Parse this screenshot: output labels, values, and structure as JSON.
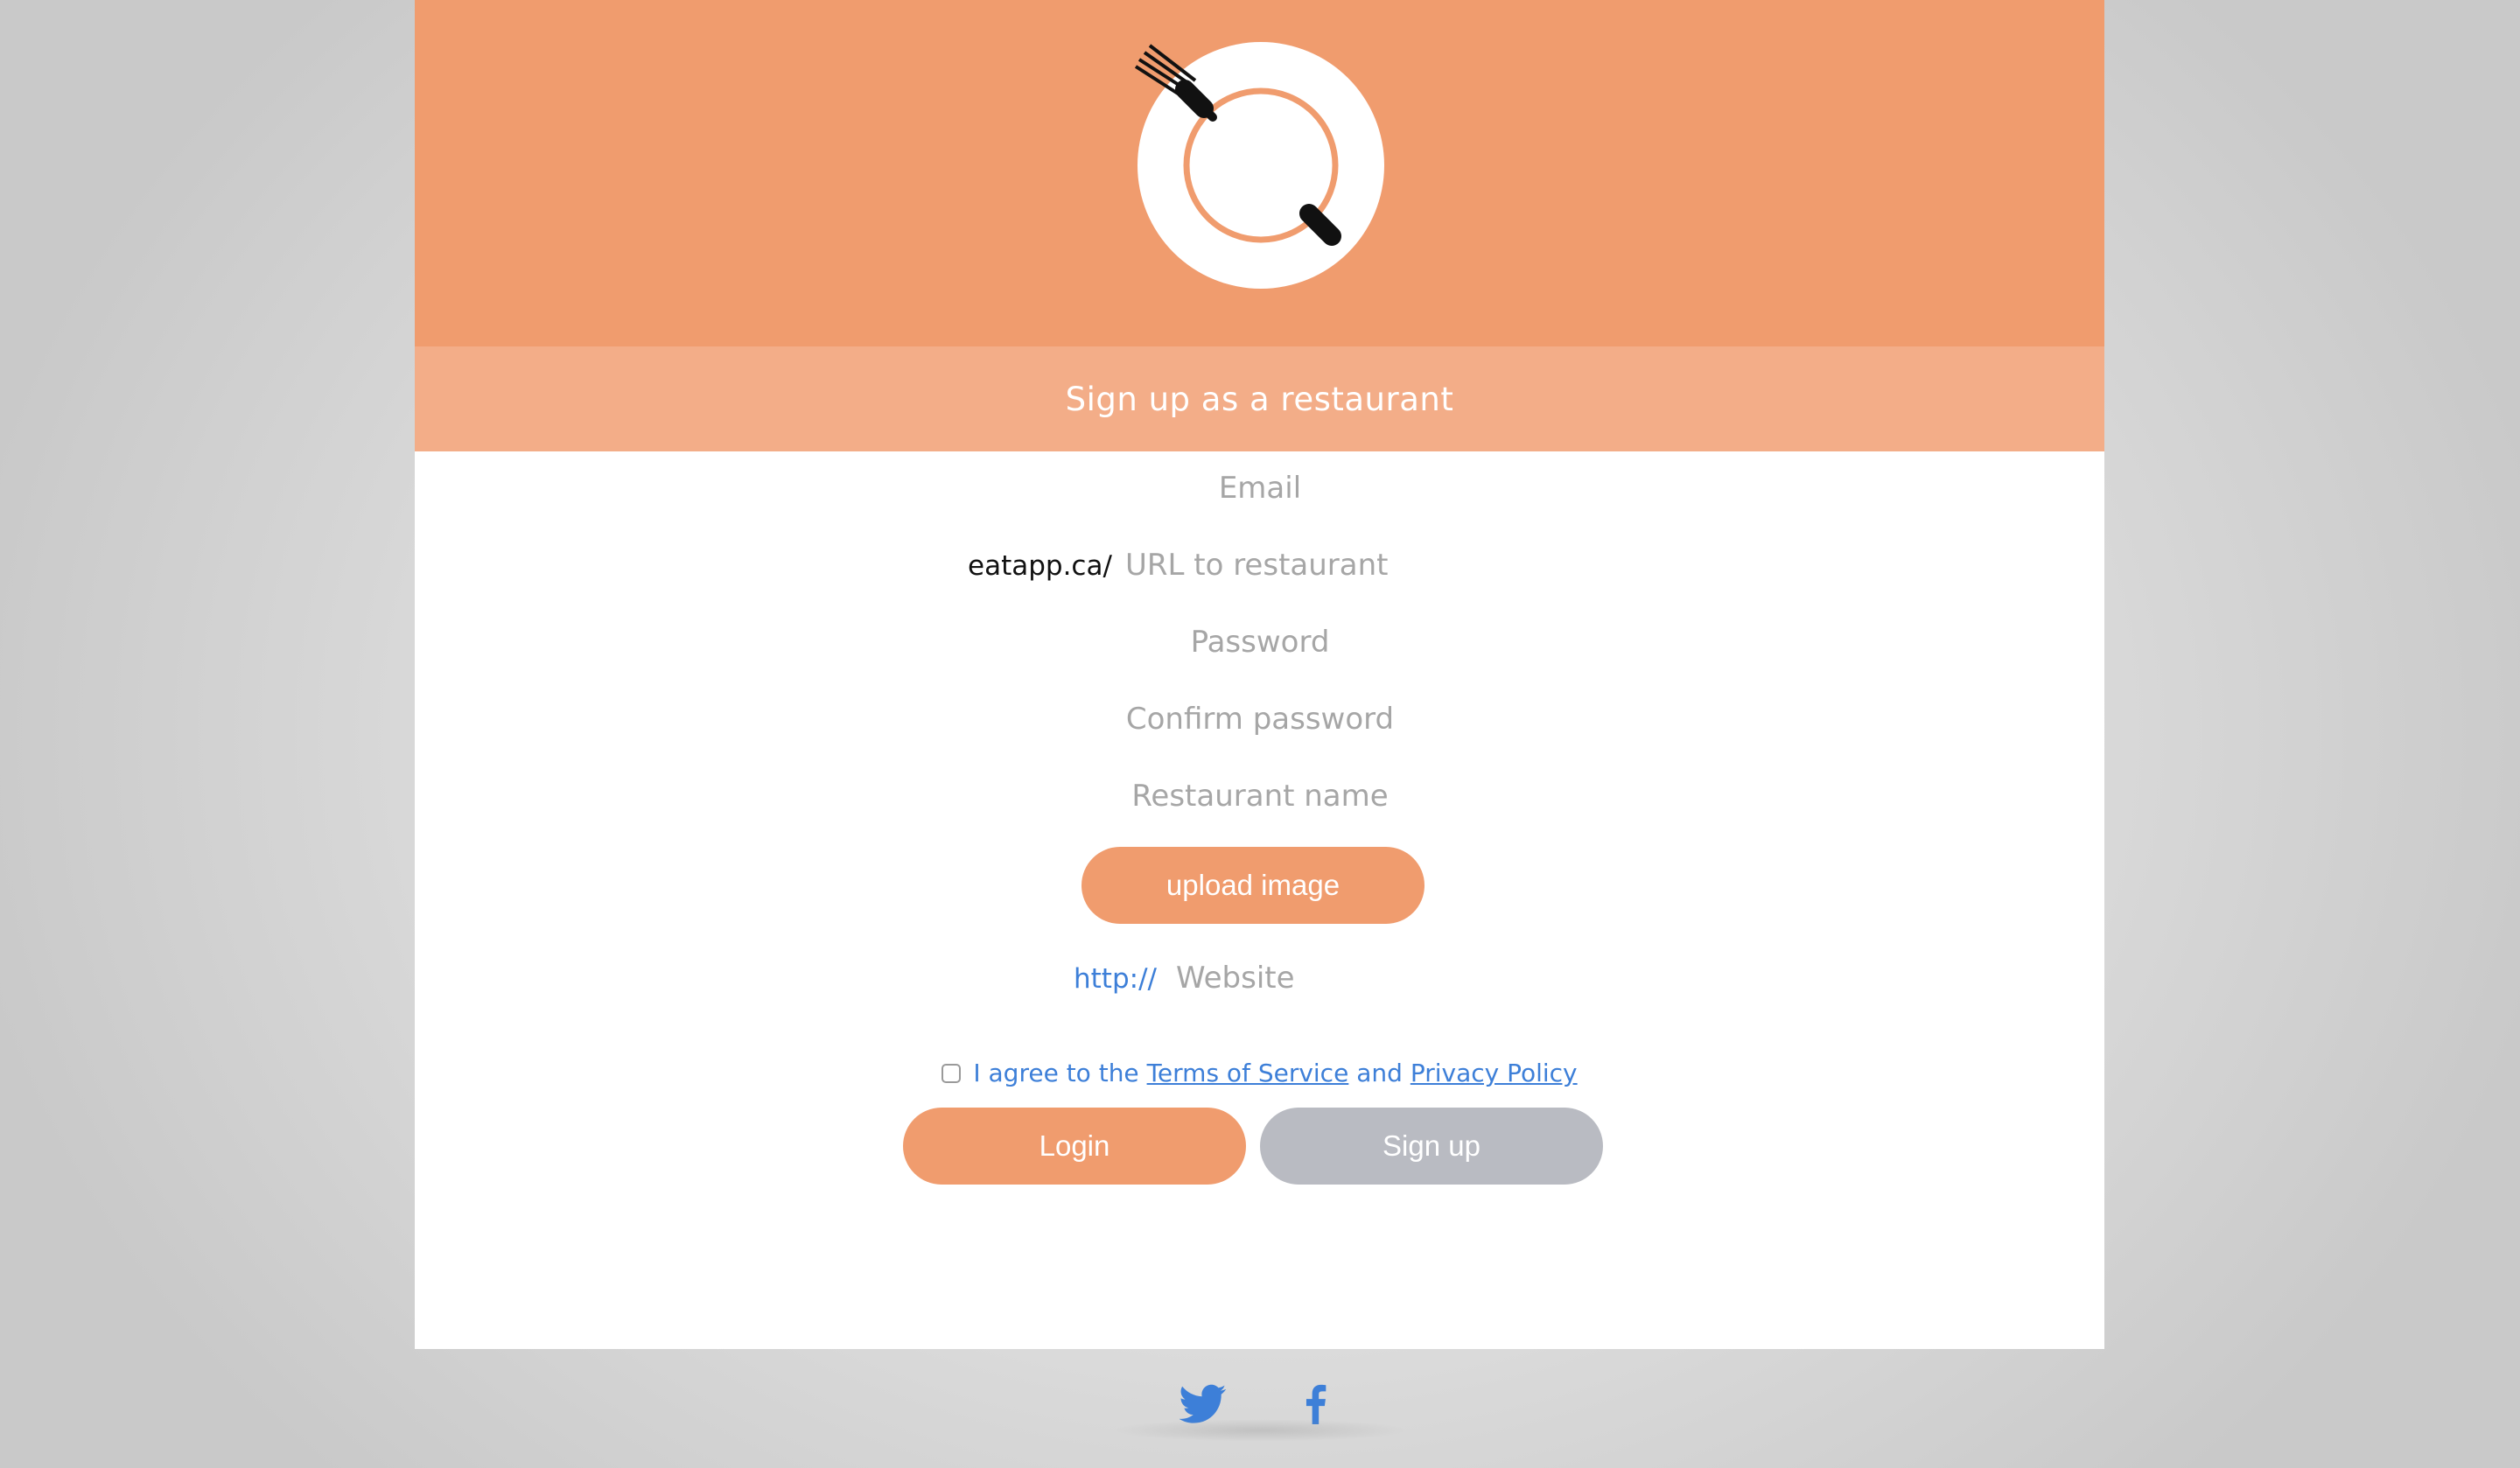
{
  "header": {
    "logo_icon": "plate-fork-icon",
    "background_color": "#f09c6e",
    "title": "Sign up as a restaurant"
  },
  "form": {
    "email_placeholder": "Email",
    "url_prefix": "eatapp.ca/",
    "url_placeholder": "URL to restaurant",
    "password_placeholder": "Password",
    "confirm_password_placeholder": "Confirm password",
    "restaurant_name_placeholder": "Restaurant name",
    "upload_label": "upload image",
    "website_prefix": "http://",
    "website_placeholder": "Website",
    "agree": {
      "text_before": "I agree to the",
      "terms_link": "Terms of Service",
      "and_text": "and",
      "privacy_link": "Privacy Policy"
    },
    "login_label": "Login",
    "signup_label": "Sign up"
  },
  "footer": {
    "social": [
      {
        "icon": "twitter-icon"
      },
      {
        "icon": "facebook-icon"
      }
    ]
  },
  "colors": {
    "accent": "#f09c6e",
    "accent_light": "#f3ad88",
    "button_disabled": "#b9bbc2",
    "link": "#3d7fd8"
  }
}
